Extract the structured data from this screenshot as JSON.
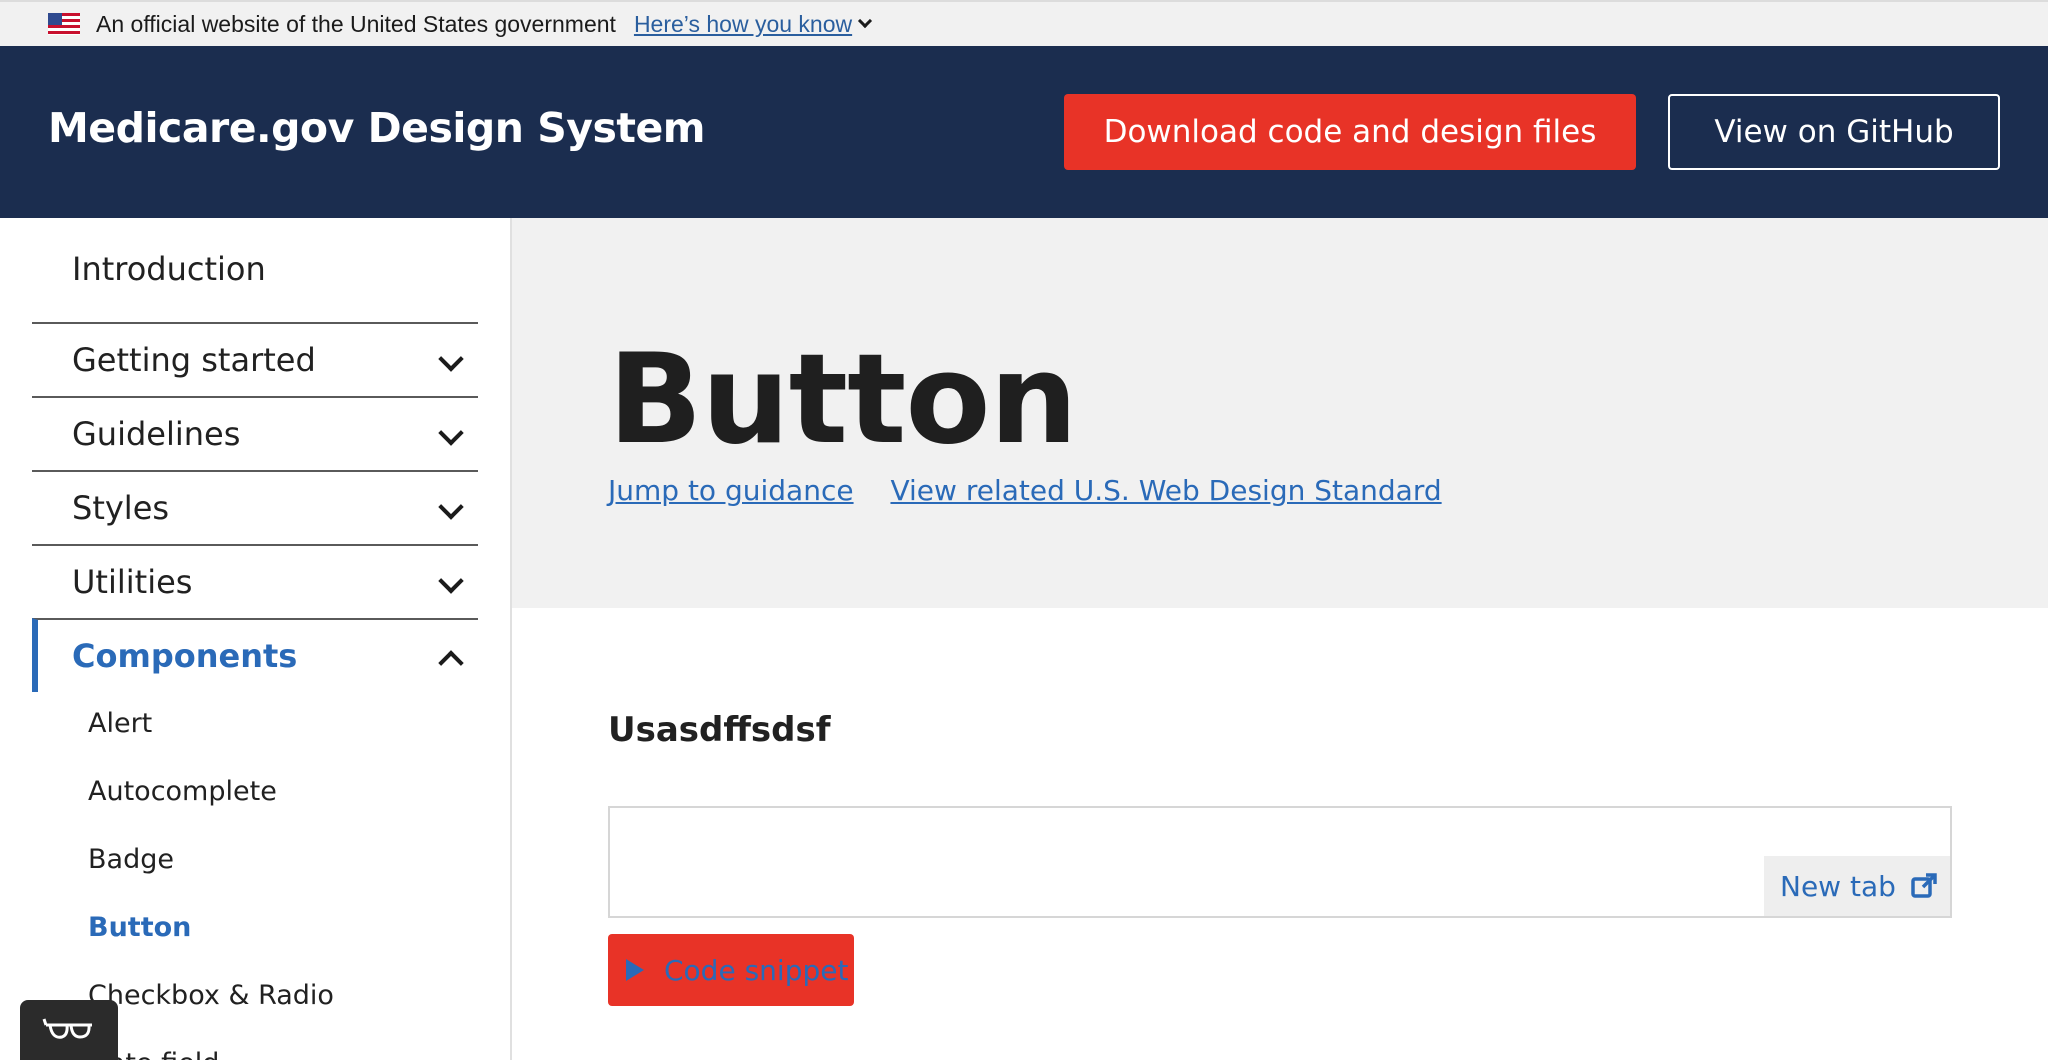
{
  "gov_banner": {
    "text": "An official website of the United States government",
    "link": "Here’s how you know"
  },
  "header": {
    "title": "Medicare.gov Design System",
    "download_label": "Download code and design files",
    "github_label": "View on GitHub"
  },
  "sidebar": {
    "items": [
      {
        "label": "Introduction"
      },
      {
        "label": "Getting started"
      },
      {
        "label": "Guidelines"
      },
      {
        "label": "Styles"
      },
      {
        "label": "Utilities"
      },
      {
        "label": "Components"
      }
    ],
    "sub_items": [
      {
        "label": "Alert"
      },
      {
        "label": "Autocomplete"
      },
      {
        "label": "Badge"
      },
      {
        "label": "Button"
      },
      {
        "label": "Checkbox & Radio"
      },
      {
        "label": "Date field"
      }
    ]
  },
  "hero": {
    "title": "Button",
    "link_guidance": "Jump to guidance",
    "link_uswds": "View related U.S. Web Design Standard"
  },
  "main": {
    "section_heading": "Usasdffsdsf",
    "new_tab_label": "New tab",
    "code_snippet_label": "Code snippet"
  },
  "colors": {
    "header_bg": "#1b2d4f",
    "primary_red": "#e83327",
    "link_blue": "#2a6ab8",
    "hero_bg": "#f1f1f1"
  }
}
